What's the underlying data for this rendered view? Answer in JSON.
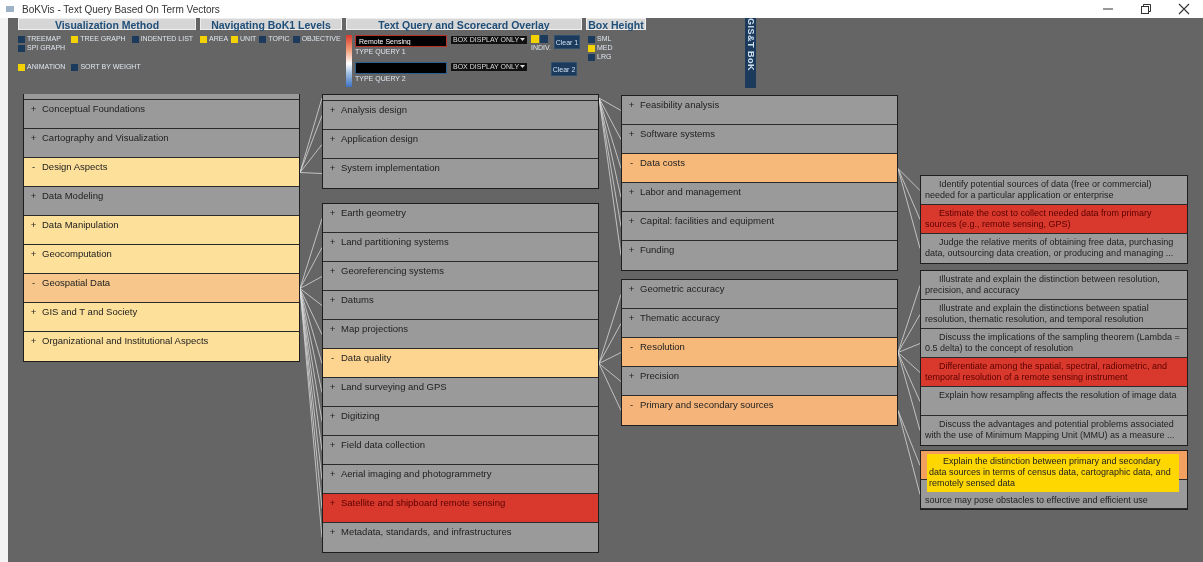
{
  "window": {
    "title": "BoKVis - Text Query Based On Term Vectors"
  },
  "visualization_method": {
    "title": "Visualization Method",
    "options": [
      {
        "label": "TREEMAP",
        "checked": false
      },
      {
        "label": "SPI GRAPH",
        "checked": false
      },
      {
        "label": "TREE GRAPH",
        "checked": true
      },
      {
        "label": "INDENTED LIST",
        "checked": false
      },
      {
        "label": "ANIMATION",
        "checked": true
      },
      {
        "label": "SORT BY WEIGHT",
        "checked": false
      }
    ]
  },
  "levels": {
    "title": "Navigating BoK1 Levels",
    "options": [
      {
        "label": "AREA",
        "checked": true
      },
      {
        "label": "UNIT",
        "checked": true
      },
      {
        "label": "TOPIC",
        "checked": false
      },
      {
        "label": "OBJECTIVE",
        "checked": false
      }
    ]
  },
  "text_query": {
    "title": "Text Query and Scorecard Overlay",
    "queries": [
      {
        "value": "Remote Sensing",
        "label": "TYPE QUERY 1",
        "mode": "BOX DISPLAY ONLY",
        "clear": "Clear 1",
        "color": "#b8322a"
      },
      {
        "label": "TYPE QUERY 2",
        "mode": "BOX DISPLAY ONLY",
        "clear": "Clear 2",
        "color": "#2f5f8f"
      }
    ],
    "indiv": {
      "label": "INDIV.",
      "options": [
        {
          "checked": true
        },
        {
          "checked": false
        }
      ]
    }
  },
  "box_height": {
    "title": "Box Height",
    "options": [
      {
        "label": "SML",
        "checked": false
      },
      {
        "label": "MED",
        "checked": true
      },
      {
        "label": "LRG",
        "checked": false
      }
    ]
  },
  "logo": {
    "text": "GIS&T BoK"
  },
  "tree": [
    {
      "kind": "clipped"
    },
    {
      "kind": "node",
      "toggle": "+",
      "label": "Conceptual Foundations",
      "color": "#9a9a9a"
    },
    {
      "kind": "node",
      "toggle": "+",
      "label": "Cartography and Visualization",
      "color": "#9a9a9a"
    },
    {
      "kind": "node",
      "toggle": "-",
      "label": "Design Aspects",
      "color": "#fde09a",
      "clipped_child": {
        "children": [
          {
            "kind": "node",
            "toggle": "+",
            "label": "Feasibility analysis",
            "color": "#9a9a9a"
          },
          {
            "kind": "node",
            "toggle": "+",
            "label": "Software systems",
            "color": "#9a9a9a"
          },
          {
            "kind": "node",
            "toggle": "-",
            "label": "Data costs",
            "color": "#f6b97a",
            "children": [
              {
                "kind": "objective",
                "label": "Identify potential sources of data (free or commercial) needed for a particular application or enterprise",
                "color": "#9a9a9a"
              },
              {
                "kind": "objective",
                "label": "Estimate the cost to collect needed data from primary sources (e.g., remote sensing, GPS)",
                "color": "#d9392c"
              },
              {
                "kind": "objective",
                "label": "Judge the relative merits of obtaining free data, purchasing data, outsourcing data creation, or producing and managing ...",
                "color": "#9a9a9a"
              }
            ]
          },
          {
            "kind": "node",
            "toggle": "+",
            "label": "Labor and management",
            "color": "#9a9a9a"
          },
          {
            "kind": "node",
            "toggle": "+",
            "label": "Capital: facilities and equipment",
            "color": "#9a9a9a"
          },
          {
            "kind": "node",
            "toggle": "+",
            "label": "Funding",
            "color": "#9a9a9a"
          }
        ]
      },
      "children": [
        {
          "kind": "node",
          "toggle": "+",
          "label": "Analysis design",
          "color": "#9a9a9a"
        },
        {
          "kind": "node",
          "toggle": "+",
          "label": "Application design",
          "color": "#9a9a9a"
        },
        {
          "kind": "node",
          "toggle": "+",
          "label": "System implementation",
          "color": "#9a9a9a"
        }
      ]
    },
    {
      "kind": "node",
      "toggle": "+",
      "label": "Data Modeling",
      "color": "#9a9a9a"
    },
    {
      "kind": "node",
      "toggle": "+",
      "label": "Data Manipulation",
      "color": "#fde09a"
    },
    {
      "kind": "node",
      "toggle": "+",
      "label": "Geocomputation",
      "color": "#fde09a"
    },
    {
      "kind": "node",
      "toggle": "-",
      "label": "Geospatial Data",
      "color": "#f6c68a",
      "children": [
        {
          "kind": "node",
          "toggle": "+",
          "label": "Earth geometry",
          "color": "#9a9a9a"
        },
        {
          "kind": "node",
          "toggle": "+",
          "label": "Land partitioning systems",
          "color": "#9a9a9a"
        },
        {
          "kind": "node",
          "toggle": "+",
          "label": "Georeferencing systems",
          "color": "#9a9a9a"
        },
        {
          "kind": "node",
          "toggle": "+",
          "label": "Datums",
          "color": "#9a9a9a"
        },
        {
          "kind": "node",
          "toggle": "+",
          "label": "Map projections",
          "color": "#9a9a9a"
        },
        {
          "kind": "node",
          "toggle": "-",
          "label": "Data quality",
          "color": "#fdd590",
          "children": [
            {
              "kind": "node",
              "toggle": "+",
              "label": "Geometric accuracy",
              "color": "#9a9a9a"
            },
            {
              "kind": "node",
              "toggle": "+",
              "label": "Thematic accuracy",
              "color": "#9a9a9a"
            },
            {
              "kind": "node",
              "toggle": "-",
              "label": "Resolution",
              "color": "#f6b97a",
              "children": [
                {
                  "kind": "objective",
                  "label": "Illustrate and explain the distinction between resolution, precision, and accuracy",
                  "color": "#9a9a9a"
                },
                {
                  "kind": "objective",
                  "label": "Illustrate and explain the distinctions between spatial resolution, thematic resolution, and temporal resolution",
                  "color": "#9a9a9a"
                },
                {
                  "kind": "objective",
                  "label": "Discuss the implications of the sampling theorem (Lambda = 0.5 delta) to the concept of resolution",
                  "color": "#9a9a9a"
                },
                {
                  "kind": "objective",
                  "label": "Differentiate among the spatial, spectral, radiometric, and temporal resolution of a remote sensing instrument",
                  "color": "#d9392c"
                },
                {
                  "kind": "objective",
                  "label": "Explain how resampling affects the resolution of image data",
                  "color": "#9a9a9a"
                },
                {
                  "kind": "objective",
                  "label": "Discuss the advantages and potential problems associated with the use of Minimum Mapping Unit (MMU) as a measure ...",
                  "color": "#9a9a9a"
                }
              ]
            },
            {
              "kind": "node",
              "toggle": "+",
              "label": "Precision",
              "color": "#9a9a9a"
            },
            {
              "kind": "node",
              "toggle": "-",
              "label": "Primary and secondary sources",
              "color": "#f4b47a",
              "children": [
                {
                  "kind": "covered",
                  "color": "#f2a060",
                  "tooltip": "Explain the distinction between primary and secondary data sources in terms of census data, cartographic data, and remotely sensed data"
                },
                {
                  "kind": "partial",
                  "label": "source may pose obstacles to effective and efficient use",
                  "color": "#9a9a9a"
                }
              ]
            }
          ]
        },
        {
          "kind": "node",
          "toggle": "+",
          "label": "Land surveying and GPS",
          "color": "#9a9a9a"
        },
        {
          "kind": "node",
          "toggle": "+",
          "label": "Digitizing",
          "color": "#9a9a9a"
        },
        {
          "kind": "node",
          "toggle": "+",
          "label": "Field data collection",
          "color": "#9a9a9a"
        },
        {
          "kind": "node",
          "toggle": "+",
          "label": "Aerial imaging and photogrammetry",
          "color": "#9a9a9a"
        },
        {
          "kind": "node",
          "toggle": "+",
          "label": "Satellite and shipboard remote sensing",
          "color": "#d9392c"
        },
        {
          "kind": "node",
          "toggle": "+",
          "label": "Metadata, standards, and infrastructures",
          "color": "#9a9a9a"
        }
      ]
    },
    {
      "kind": "node",
      "toggle": "+",
      "label": "GIS and T and Society",
      "color": "#fde09a"
    },
    {
      "kind": "node",
      "toggle": "+",
      "label": "Organizational and Institutional Aspects",
      "color": "#fde09a"
    }
  ]
}
